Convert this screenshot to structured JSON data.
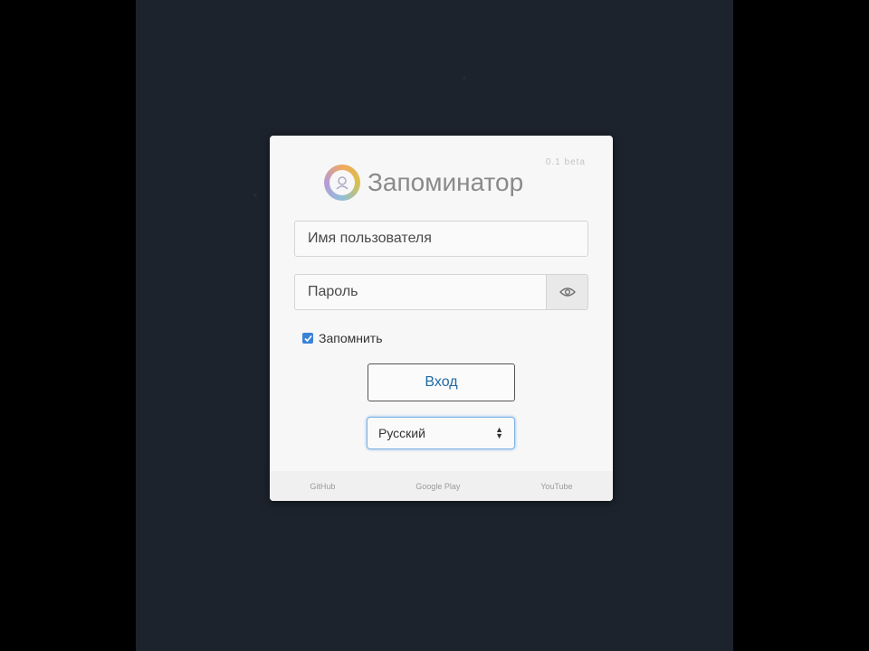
{
  "app": {
    "name": "Запоминатор",
    "version": "0.1 beta"
  },
  "login": {
    "username_placeholder": "Имя пользователя",
    "password_placeholder": "Пароль",
    "remember_label": "Запомнить",
    "remember_checked": true,
    "submit_label": "Вход",
    "language_selected": "Русский"
  },
  "footer": {
    "links": [
      "GitHub",
      "Google Play",
      "YouTube"
    ]
  },
  "icons": {
    "logo": "app-logo-icon",
    "password_toggle": "eye-icon",
    "checkbox": "check-icon",
    "select_arrows": "chevron-up-down-icon"
  },
  "colors": {
    "background": "#1c232d",
    "card": "#f7f7f7",
    "accent": "#3b82d6",
    "button_text": "#1f6aa5"
  }
}
